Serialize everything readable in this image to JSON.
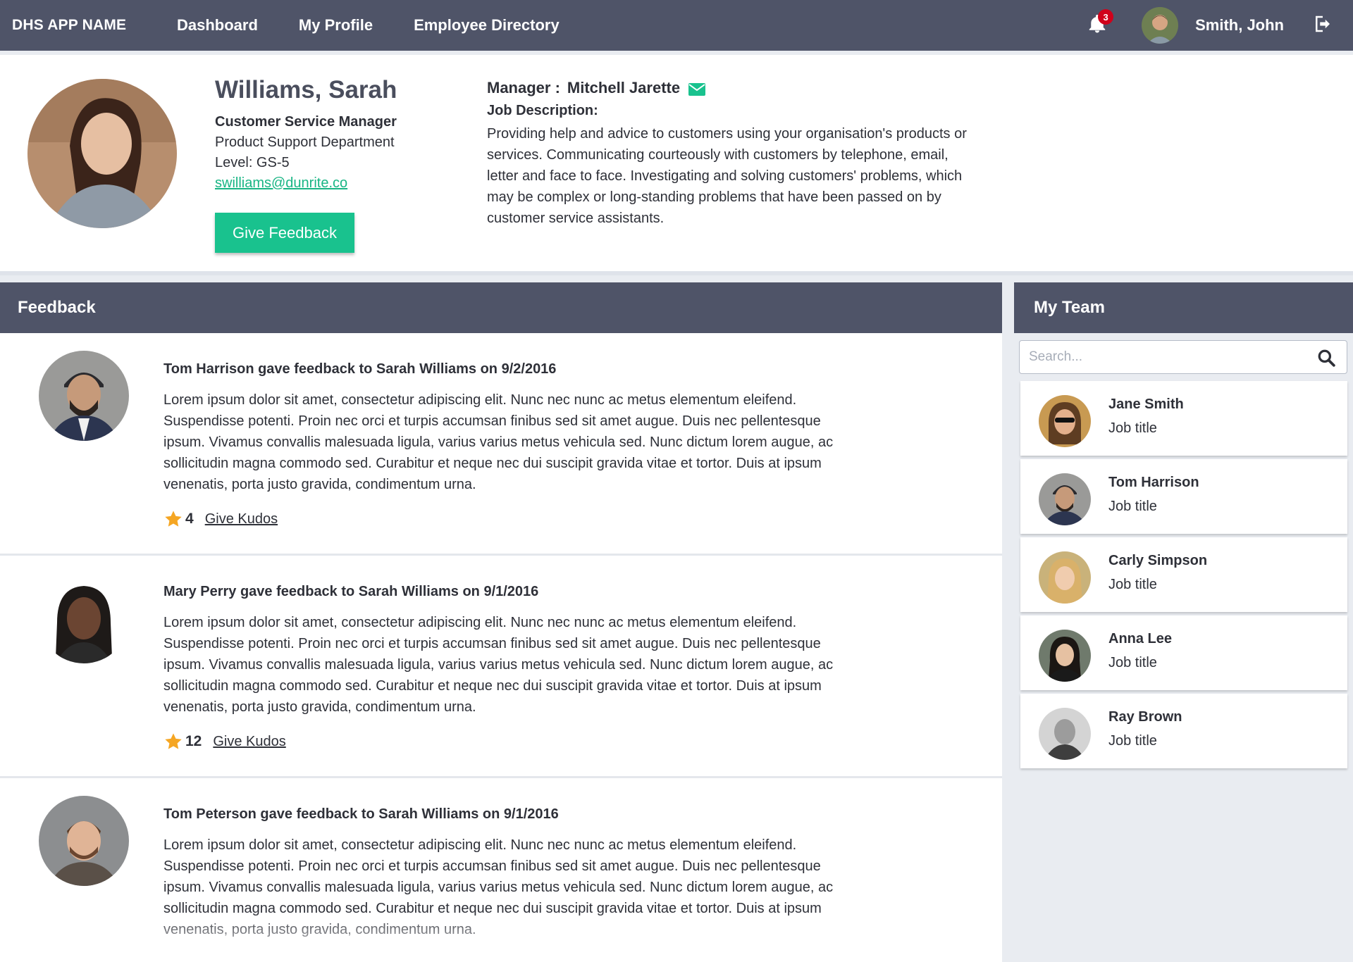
{
  "app": {
    "name": "DHS APP NAME"
  },
  "nav": {
    "links": [
      "Dashboard",
      "My Profile",
      "Employee Directory"
    ],
    "notifications_count": "3",
    "user_name": "Smith, John"
  },
  "profile": {
    "name": "Williams, Sarah",
    "title": "Customer Service Manager",
    "department": "Product Support Department",
    "level": "Level: GS-5",
    "email": "swilliams@dunrite.co",
    "give_feedback_label": "Give Feedback",
    "manager_label": "Manager :",
    "manager_name": "Mitchell Jarette",
    "job_description_label": "Job Description:",
    "job_description": "Providing help and advice to customers using your organisation's products or services.  Communicating courteously with customers by telephone, email, letter and face to face.  Investigating and solving customers' problems, which may be complex or long-standing problems that have been passed on by customer service assistants."
  },
  "feedback": {
    "header": "Feedback",
    "items": [
      {
        "heading": "Tom Harrison gave feedback to Sarah Williams on 9/2/2016",
        "body": "Lorem ipsum dolor sit amet, consectetur adipiscing elit. Nunc nec nunc ac metus elementum eleifend. Suspendisse potenti. Proin nec orci et turpis accumsan finibus sed sit amet augue. Duis nec pellentesque ipsum. Vivamus convallis malesuada ligula, varius varius metus vehicula sed. Nunc dictum lorem augue, ac sollicitudin magna commodo sed. Curabitur et neque nec dui suscipit gravida vitae et tortor. Duis at ipsum venenatis, porta justo gravida, condimentum urna.",
        "kudos": "4",
        "kudos_label": "Give Kudos"
      },
      {
        "heading": "Mary Perry gave feedback to Sarah Williams on 9/1/2016",
        "body": "Lorem ipsum dolor sit amet, consectetur adipiscing elit. Nunc nec nunc ac metus elementum eleifend. Suspendisse potenti. Proin nec orci et turpis accumsan finibus sed sit amet augue. Duis nec pellentesque ipsum. Vivamus convallis malesuada ligula, varius varius metus vehicula sed. Nunc dictum lorem augue, ac sollicitudin magna commodo sed. Curabitur et neque nec dui suscipit gravida vitae et tortor. Duis at ipsum venenatis, porta justo gravida, condimentum urna.",
        "kudos": "12",
        "kudos_label": "Give Kudos"
      },
      {
        "heading": "Tom Peterson gave feedback to Sarah Williams  on 9/1/2016",
        "body": "Lorem ipsum dolor sit amet, consectetur adipiscing elit. Nunc nec nunc ac metus elementum eleifend. Suspendisse potenti. Proin nec orci et turpis accumsan finibus sed sit amet augue. Duis nec pellentesque ipsum. Vivamus convallis malesuada ligula, varius varius metus vehicula sed. Nunc dictum lorem augue, ac sollicitudin magna commodo sed. Curabitur et neque nec dui suscipit gravida vitae et tortor. Duis at ipsum venenatis, porta justo gravida, condimentum urna."
      }
    ]
  },
  "team": {
    "header": "My Team",
    "search_placeholder": "Search...",
    "members": [
      {
        "name": "Jane Smith",
        "title": "Job title"
      },
      {
        "name": "Tom Harrison",
        "title": "Job title"
      },
      {
        "name": "Carly Simpson",
        "title": "Job title"
      },
      {
        "name": "Anna Lee",
        "title": "Job title"
      },
      {
        "name": "Ray Brown",
        "title": "Job title"
      }
    ]
  },
  "colors": {
    "nav_bg": "#4f5468",
    "accent_green": "#19c28e",
    "badge_red": "#d0021b",
    "star_orange": "#f5a623"
  }
}
